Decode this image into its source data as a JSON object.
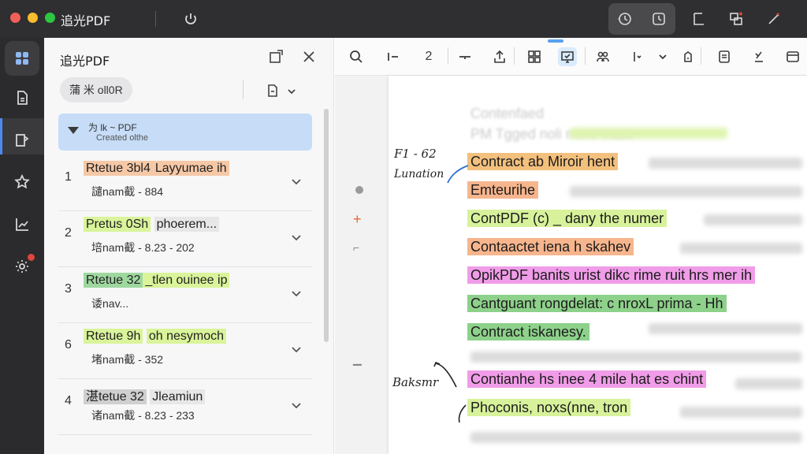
{
  "window": {
    "title": "追光PDF",
    "icons": [
      "power-icon",
      "history-icon",
      "clock-icon",
      "crop-icon",
      "layout-icon",
      "settings-tool-icon"
    ]
  },
  "rail": {
    "items": [
      "apps-icon",
      "document-icon",
      "bookmark-icon",
      "star-icon",
      "chart-icon",
      "settings-icon"
    ]
  },
  "sidebar": {
    "title": "追光PDF",
    "chip_label": "蒲 米 oll0R",
    "outline": {
      "title": "为 lk ~ PDF",
      "subtitle": "Created olthe"
    },
    "rows": [
      {
        "num": "1",
        "title_a": "Rtetue 3bl4",
        "title_b": "Layyumae ih",
        "meta": "譴nam截 - 884",
        "hl_a": "orange",
        "hl_b": "orange"
      },
      {
        "num": "2",
        "title_a": "Pretus 0Sh",
        "title_b": "phoerem...",
        "meta": "培nam截 - 8.23 - 202",
        "hl_a": "lime",
        "hl_b": "lightgrey"
      },
      {
        "num": "3",
        "title_a": "Rtetue 32",
        "title_b": "_tlen ouinee ip",
        "meta": "诿nav...",
        "hl_a": "green",
        "hl_b": "lime"
      },
      {
        "num": "6",
        "title_a": "Rtetue 9h",
        "title_b": "oh nesymoch",
        "meta": "堵nam截 - 352",
        "hl_a": "lime",
        "hl_b": "lime"
      },
      {
        "num": "4",
        "title_a": "湛tetue 32",
        "title_b": "Jleamiun",
        "meta": "诸nam截 - 8.23 - 233",
        "hl_a": "grey",
        "hl_b": "lightgrey"
      }
    ]
  },
  "toolbar": {
    "page_number": "2"
  },
  "document": {
    "annotation_top": "F1 - 62",
    "annotation_top2": "Lunation",
    "annotation_bottom": "Baksmr",
    "lines": [
      {
        "text": "Contract ab Miroir hent",
        "hl": "tan"
      },
      {
        "text": "Emteurihe",
        "hl": "peach"
      },
      {
        "text": "ContPDF (c) _ dany the numer",
        "hl": "lgreen"
      },
      {
        "text": "Contaactet iena h skahev",
        "hl": "peach"
      },
      {
        "text": "OpikPDF banits urist dikc rime ruit hrs mer ih",
        "hl": "pink"
      },
      {
        "text": "Cantguant rongdelat: c nroxL prima - Hh",
        "hl": "dgreen"
      },
      {
        "text": "Contract iskanesy.",
        "hl": "dgreen"
      },
      {
        "text": "Contianhe hs inee 4 mile hat es chint",
        "hl": "pink"
      },
      {
        "text": "Phoconis, noxs(nne, tron",
        "hl": "lgreen"
      }
    ],
    "blurred_top": [
      "Contenfaed",
      "PM Tgged noli more mast"
    ]
  },
  "colors": {
    "accent": "#4d8af0",
    "titlebar": "#2f2f31",
    "rail": "#2b2b2d",
    "outline_head": "#c6dcf7"
  }
}
